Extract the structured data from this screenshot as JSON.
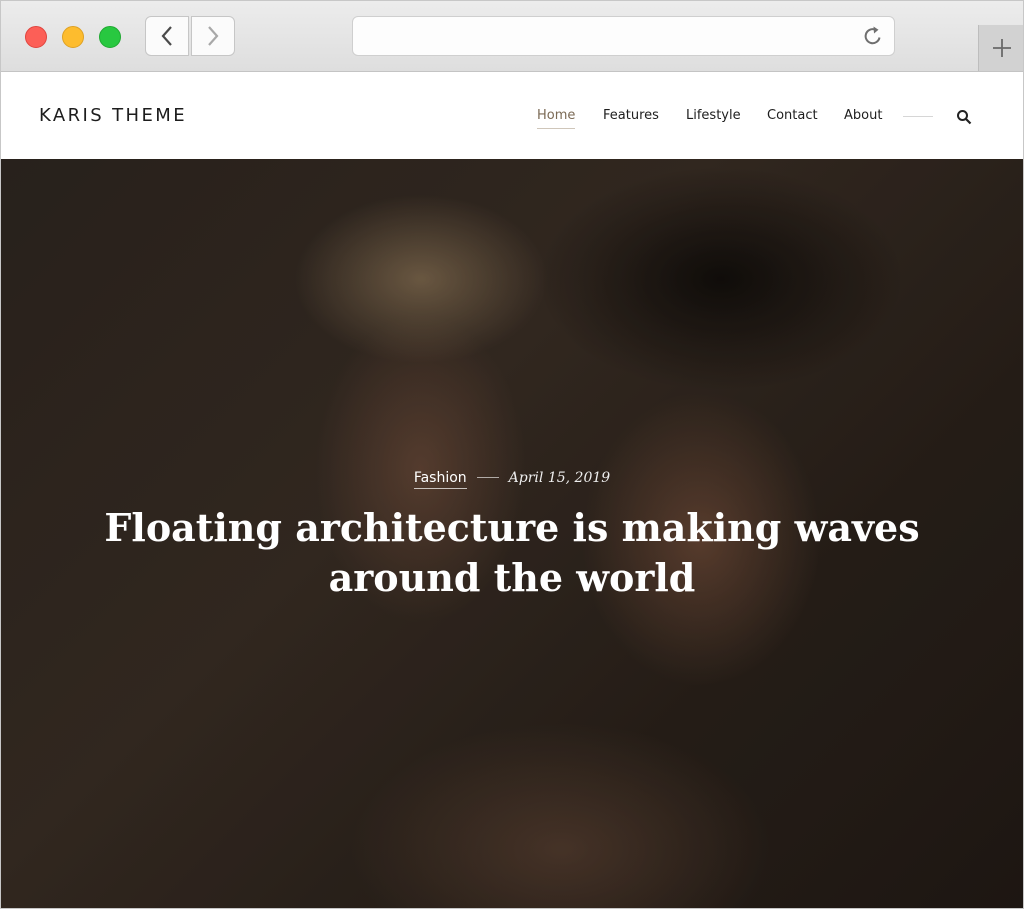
{
  "browser": {
    "back_icon": "chevron-left-icon",
    "forward_icon": "chevron-right-icon",
    "reload_icon": "reload-icon",
    "new_tab_icon": "plus-icon",
    "url": ""
  },
  "site": {
    "brand": "KARIS THEME",
    "nav": [
      {
        "label": "Home",
        "active": true
      },
      {
        "label": "Features"
      },
      {
        "label": "Lifestyle"
      },
      {
        "label": "Contact"
      },
      {
        "label": "About"
      }
    ],
    "search_icon": "search-icon"
  },
  "hero": {
    "category": "Fashion",
    "date": "April 15, 2019",
    "title": "Floating architecture is making waves around the world"
  },
  "colors": {
    "nav_active": "#7b6a55",
    "traffic_red": "#fc5f57",
    "traffic_yellow": "#fdbc2e",
    "traffic_green": "#28c840"
  }
}
